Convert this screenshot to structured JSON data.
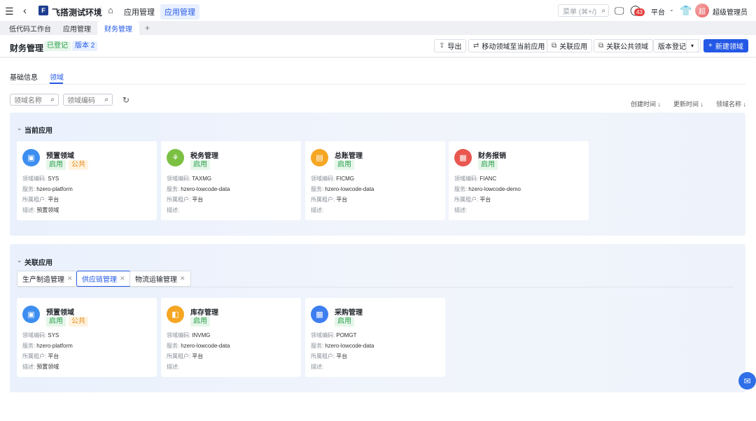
{
  "topbar": {
    "app_name": "飞搭测试环境",
    "breadcrumbs": [
      "应用管理",
      "应用管理"
    ],
    "menu_search_placeholder": "菜单 (⌘+/)",
    "notification_count": "43",
    "tenant": "平台",
    "user_name": "超级管理员",
    "avatar_text": "超"
  },
  "tabs": [
    "低代码工作台",
    "应用管理",
    "财务管理"
  ],
  "header": {
    "title": "财务管理",
    "status_tag": "已登记",
    "version_tag": "版本 2",
    "buttons": {
      "export": "导出",
      "move": "移动领域至当前应用",
      "link_app": "关联应用",
      "link_public": "关联公共领域",
      "version_register": "版本登记",
      "new_domain": "新建领域"
    }
  },
  "subtabs": [
    "基础信息",
    "领域"
  ],
  "filters": {
    "domain_name_placeholder": "领域名称",
    "domain_code_placeholder": "领域编码"
  },
  "sorts": [
    "创建时间 ↓",
    "更新时间 ↓",
    "领域名称 ↓"
  ],
  "labels": {
    "code": "领域编码:",
    "service": "服务:",
    "tenant": "所属租户:",
    "desc": "描述:"
  },
  "current_section": {
    "title": "当前应用",
    "cards": [
      {
        "name": "预置领域",
        "tags": [
          "启用",
          "公共"
        ],
        "code": "SYS",
        "service": "hzero-platform",
        "tenant": "平台",
        "desc": "预置领域",
        "icon": "monitor-icon",
        "color": "#3d8ef0"
      },
      {
        "name": "税务管理",
        "tags": [
          "启用"
        ],
        "code": "TAXMG",
        "service": "hzero-lowcode-data",
        "tenant": "平台",
        "desc": "",
        "icon": "network-icon",
        "color": "#7bc043"
      },
      {
        "name": "总账管理",
        "tags": [
          "启用"
        ],
        "code": "FICMG",
        "service": "hzero-lowcode-data",
        "tenant": "平台",
        "desc": "",
        "icon": "document-icon",
        "color": "#f5a623"
      },
      {
        "name": "财务报销",
        "tags": [
          "启用"
        ],
        "code": "FIANC",
        "service": "hzero-lowcode-demo",
        "tenant": "平台",
        "desc": "",
        "icon": "apps-icon",
        "color": "#e9574f"
      }
    ]
  },
  "linked_section": {
    "title": "关联应用",
    "app_tabs": [
      "生产制造管理",
      "供应链管理",
      "物流运输管理"
    ],
    "active_tab": "供应链管理",
    "cards": [
      {
        "name": "预置领域",
        "tags": [
          "启用",
          "公共"
        ],
        "code": "SYS",
        "service": "hzero-platform",
        "tenant": "平台",
        "desc": "预置领域",
        "icon": "monitor-icon",
        "color": "#3d8ef0"
      },
      {
        "name": "库存管理",
        "tags": [
          "启用"
        ],
        "code": "INVMG",
        "service": "hzero-lowcode-data",
        "tenant": "平台",
        "desc": "",
        "icon": "box-icon",
        "color": "#f5a623"
      },
      {
        "name": "采购管理",
        "tags": [
          "启用"
        ],
        "code": "POMGT",
        "service": "hzero-lowcode-data",
        "tenant": "平台",
        "desc": "",
        "icon": "apps-icon",
        "color": "#3d7ef0"
      }
    ]
  }
}
